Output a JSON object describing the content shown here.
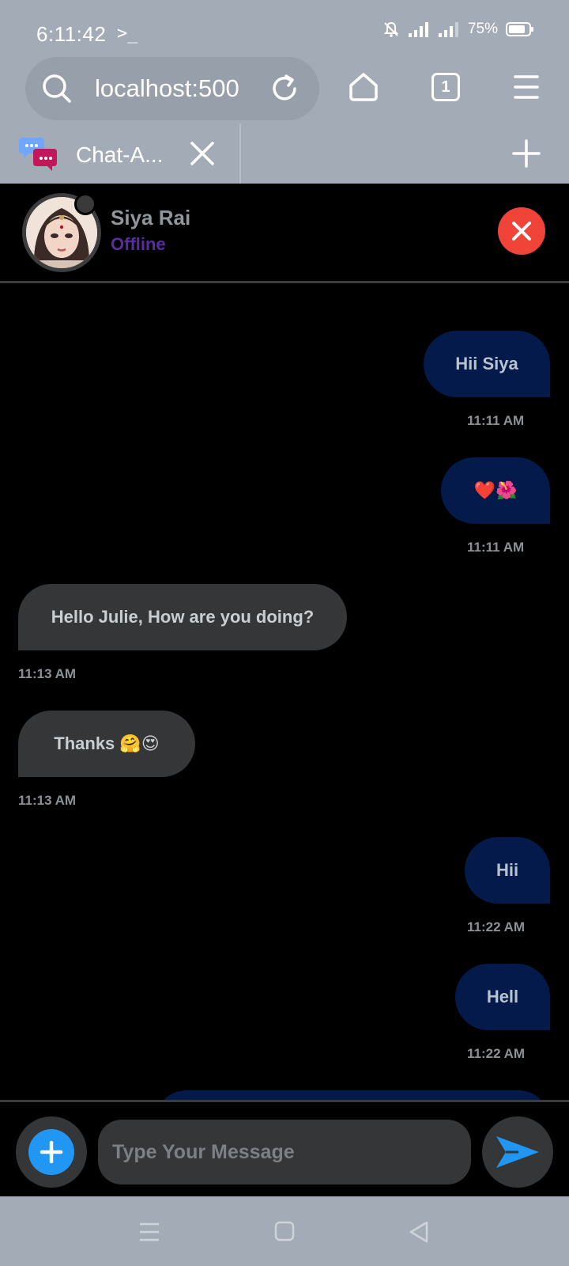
{
  "status_bar": {
    "time": "6:11:42",
    "terminal_glyph": ">_",
    "battery": "75%"
  },
  "browser": {
    "url": "localhost:500",
    "tab_count": "1",
    "tab_title": "Chat-A..."
  },
  "chat": {
    "contact_name": "Siya Rai",
    "contact_status": "Offline",
    "messages": [
      {
        "direction": "out",
        "text": "Hii Siya",
        "time": "11:11 AM"
      },
      {
        "direction": "out",
        "text": "❤️🌺",
        "time": "11:11 AM"
      },
      {
        "direction": "in",
        "text": "Hello Julie, How are you doing?",
        "time": "11:13 AM"
      },
      {
        "direction": "in",
        "text": "Thanks 🤗😍",
        "time": "11:13 AM"
      },
      {
        "direction": "out",
        "text": "Hii",
        "time": "11:22 AM"
      },
      {
        "direction": "out",
        "text": "Hell",
        "time": "11:22 AM"
      }
    ]
  },
  "composer": {
    "placeholder": "Type Your Message"
  },
  "colors": {
    "outgoing_bubble": "#041a4a",
    "incoming_bubble": "#343637",
    "status_offline": "#5b2ca0",
    "close_button": "#f04438",
    "attach_button": "#2196f3",
    "send_icon": "#2196f3",
    "chrome": "#a3acb6"
  },
  "icons": {
    "search": "search-icon",
    "reload": "reload-icon",
    "home": "home-icon",
    "menu": "menu-icon",
    "close_tab": "close-icon",
    "new_tab": "plus-icon",
    "close_chat": "close-icon",
    "attach": "plus-icon",
    "send": "send-icon"
  }
}
